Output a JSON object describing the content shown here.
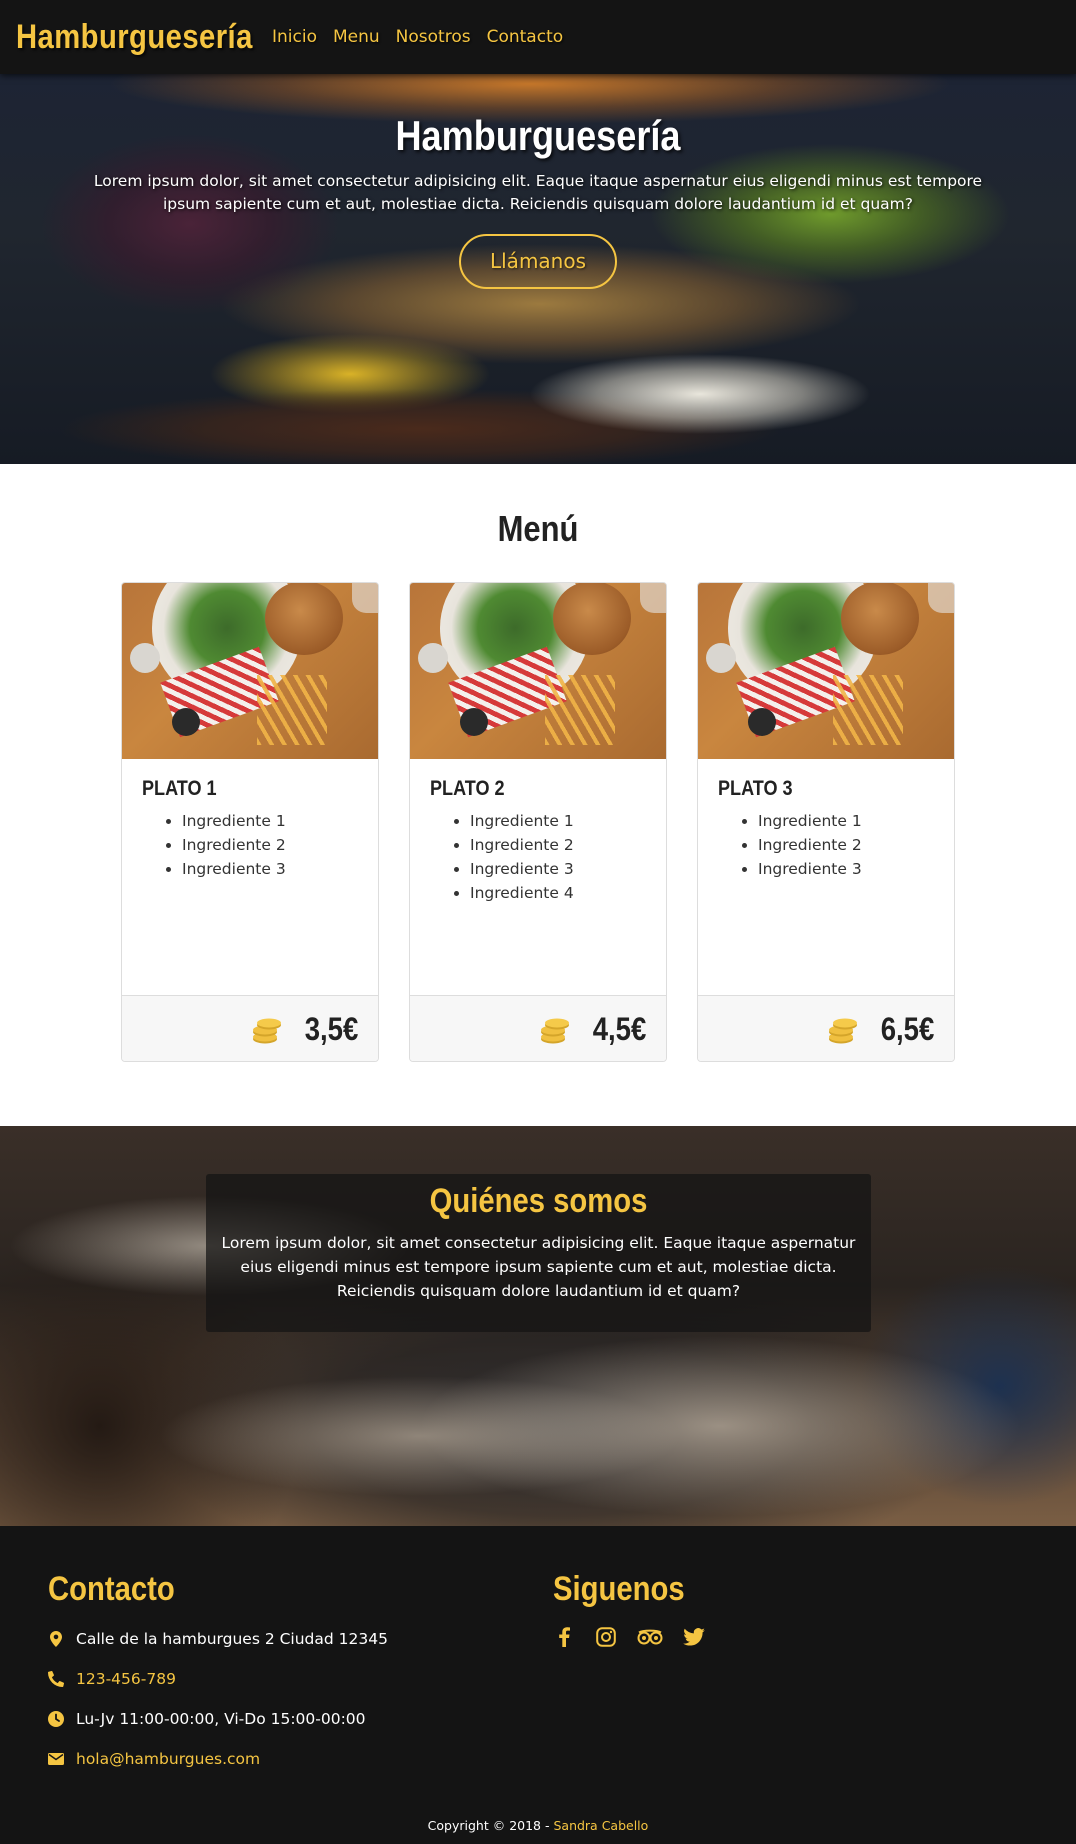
{
  "nav": {
    "brand": "Hamburguesería",
    "links": [
      "Inicio",
      "Menu",
      "Nosotros",
      "Contacto"
    ]
  },
  "hero": {
    "title": "Hamburguesería",
    "text": "Lorem ipsum dolor, sit amet consectetur adipisicing elit. Eaque itaque aspernatur eius eligendi minus est tempore ipsum sapiente cum et aut, molestiae dicta. Reiciendis quisquam dolore laudantium id et quam?",
    "button": "Llámanos"
  },
  "menu": {
    "title": "Menú",
    "items": [
      {
        "name": "PLATO 1",
        "ingredients": [
          "Ingrediente 1",
          "Ingrediente 2",
          "Ingrediente 3"
        ],
        "price": "3,5€"
      },
      {
        "name": "PLATO 2",
        "ingredients": [
          "Ingrediente 1",
          "Ingrediente 2",
          "Ingrediente 3",
          "Ingrediente 4"
        ],
        "price": "4,5€"
      },
      {
        "name": "PLATO 3",
        "ingredients": [
          "Ingrediente 1",
          "Ingrediente 2",
          "Ingrediente 3"
        ],
        "price": "6,5€"
      }
    ]
  },
  "about": {
    "title": "Quiénes somos",
    "text": "Lorem ipsum dolor, sit amet consectetur adipisicing elit. Eaque itaque aspernatur eius eligendi minus est tempore ipsum sapiente cum et aut, molestiae dicta. Reiciendis quisquam dolore laudantium id et quam?"
  },
  "footer": {
    "contact_title": "Contacto",
    "address": "Calle de la hamburgues 2 Ciudad 12345",
    "phone": "123-456-789",
    "hours": "Lu-Jv 11:00-00:00, Vi-Do 15:00-00:00",
    "email": "hola@hamburgues.com",
    "social_title": "Siguenos",
    "social_icons": [
      "facebook-icon",
      "instagram-icon",
      "tripadvisor-icon",
      "twitter-icon"
    ],
    "copyright_prefix": "Copyright © 2018 - ",
    "copyright_author": "Sandra Cabello"
  },
  "colors": {
    "accent": "#f5c542",
    "dark": "#141414"
  }
}
